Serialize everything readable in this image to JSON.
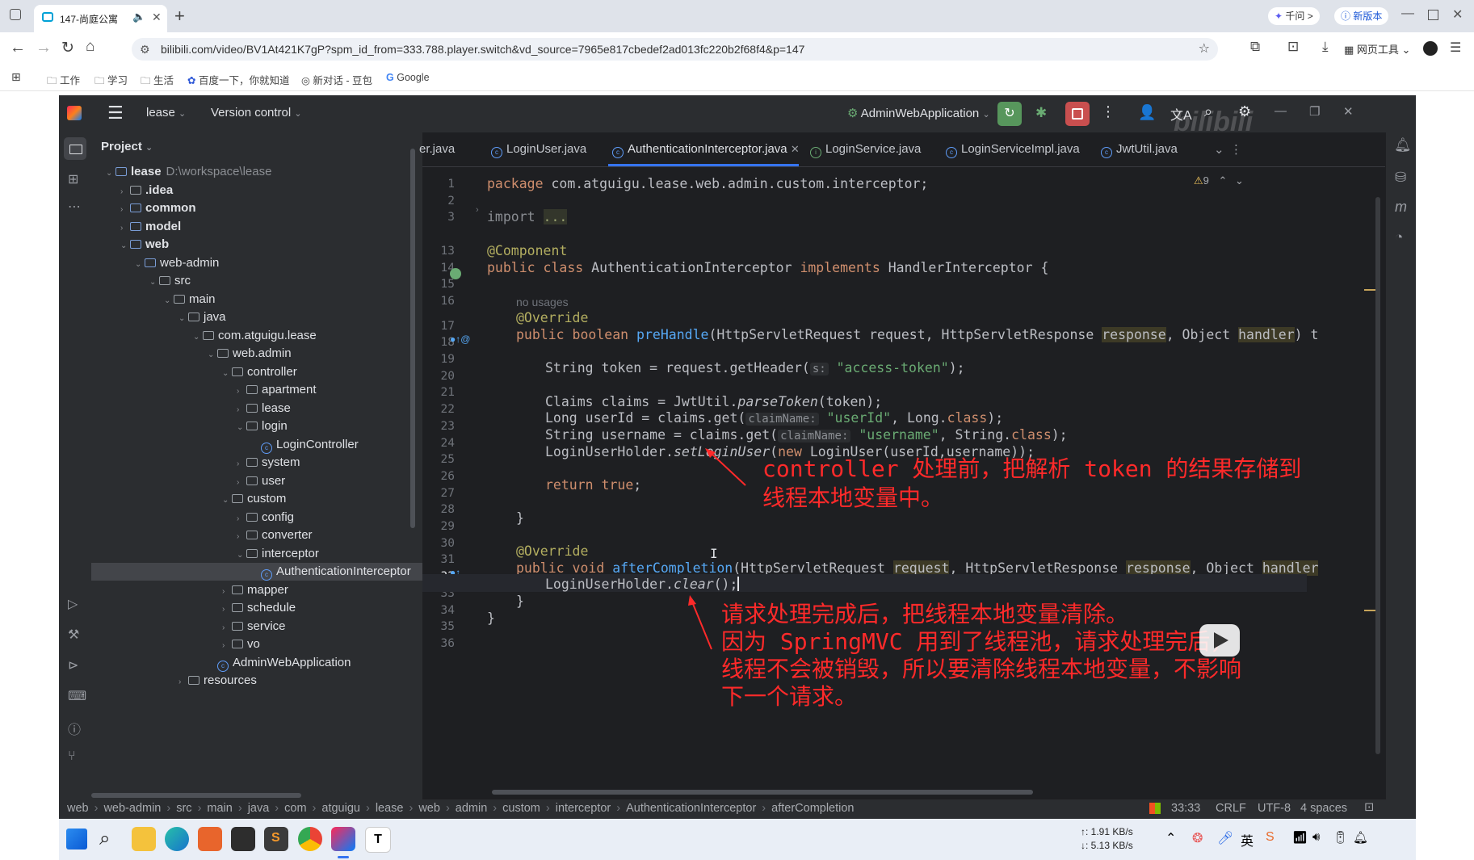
{
  "browser": {
    "tab_title": "147-尚庭公寓",
    "url": "bilibili.com/video/BV1At421K7gP?spm_id_from=333.788.player.switch&vd_source=7965e817cbedef2ad013fc220b2f68f4&p=147",
    "ask_btn": "千问 >",
    "new_version_btn": "新版本",
    "web_tools": "网页工具",
    "bookmarks": [
      "工作",
      "学习",
      "生活",
      "百度一下，你就知道",
      "新对话 - 豆包",
      "Google"
    ]
  },
  "ide": {
    "project_name": "lease",
    "version_control": "Version control",
    "run_config": "AdminWebApplication",
    "project_panel_title": "Project",
    "warnings_count": "9",
    "tabs": [
      {
        "label": "er.java",
        "active": false
      },
      {
        "label": "LoginUser.java",
        "active": false
      },
      {
        "label": "AuthenticationInterceptor.java",
        "active": true
      },
      {
        "label": "LoginService.java",
        "active": false
      },
      {
        "label": "LoginServiceImpl.java",
        "active": false
      },
      {
        "label": "JwtUtil.java",
        "active": false
      }
    ],
    "tree": [
      {
        "label": "lease",
        "extra": "D:\\workspace\\lease",
        "depth": 0,
        "arrow": "down",
        "icon": "module"
      },
      {
        "label": ".idea",
        "depth": 1,
        "arrow": "right",
        "icon": "folder"
      },
      {
        "label": "common",
        "depth": 1,
        "arrow": "right",
        "icon": "module"
      },
      {
        "label": "model",
        "depth": 1,
        "arrow": "right",
        "icon": "module"
      },
      {
        "label": "web",
        "depth": 1,
        "arrow": "down",
        "icon": "module"
      },
      {
        "label": "web-admin",
        "depth": 2,
        "arrow": "down",
        "icon": "module"
      },
      {
        "label": "src",
        "depth": 3,
        "arrow": "down",
        "icon": "folder"
      },
      {
        "label": "main",
        "depth": 4,
        "arrow": "down",
        "icon": "folder"
      },
      {
        "label": "java",
        "depth": 5,
        "arrow": "down",
        "icon": "folder"
      },
      {
        "label": "com.atguigu.lease",
        "depth": 6,
        "arrow": "down",
        "icon": "folder"
      },
      {
        "label": "web.admin",
        "depth": 7,
        "arrow": "down",
        "icon": "folder"
      },
      {
        "label": "controller",
        "depth": 8,
        "arrow": "down",
        "icon": "folder"
      },
      {
        "label": "apartment",
        "depth": 9,
        "arrow": "right",
        "icon": "folder"
      },
      {
        "label": "lease",
        "depth": 9,
        "arrow": "right",
        "icon": "folder"
      },
      {
        "label": "login",
        "depth": 9,
        "arrow": "down",
        "icon": "folder"
      },
      {
        "label": "LoginController",
        "depth": 10,
        "arrow": "",
        "icon": "class"
      },
      {
        "label": "system",
        "depth": 9,
        "arrow": "right",
        "icon": "folder"
      },
      {
        "label": "user",
        "depth": 9,
        "arrow": "right",
        "icon": "folder"
      },
      {
        "label": "custom",
        "depth": 8,
        "arrow": "down",
        "icon": "folder"
      },
      {
        "label": "config",
        "depth": 9,
        "arrow": "right",
        "icon": "folder"
      },
      {
        "label": "converter",
        "depth": 9,
        "arrow": "right",
        "icon": "folder"
      },
      {
        "label": "interceptor",
        "depth": 9,
        "arrow": "down",
        "icon": "folder"
      },
      {
        "label": "AuthenticationInterceptor",
        "depth": 10,
        "arrow": "",
        "icon": "class",
        "selected": true
      },
      {
        "label": "mapper",
        "depth": 8,
        "arrow": "right",
        "icon": "folder"
      },
      {
        "label": "schedule",
        "depth": 8,
        "arrow": "right",
        "icon": "folder"
      },
      {
        "label": "service",
        "depth": 8,
        "arrow": "right",
        "icon": "folder"
      },
      {
        "label": "vo",
        "depth": 8,
        "arrow": "right",
        "icon": "folder"
      },
      {
        "label": "AdminWebApplication",
        "depth": 7,
        "arrow": "",
        "icon": "app"
      },
      {
        "label": "resources",
        "depth": 5,
        "arrow": "right",
        "icon": "folder"
      }
    ],
    "gutter_lines": [
      "1",
      "2",
      "3",
      "13",
      "14",
      "15",
      "16",
      "17",
      "18",
      "19",
      "20",
      "21",
      "22",
      "23",
      "24",
      "25",
      "26",
      "27",
      "28",
      "29",
      "30",
      "31",
      "32",
      "33",
      "34",
      "35",
      "36"
    ],
    "code": {
      "package_kw": "package",
      "package_name": " com.atguigu.lease.web.admin.custom.interceptor;",
      "import_kw": "import",
      "import_fold": "...",
      "component": "@Component",
      "class_public": "public",
      "class_kw": "class",
      "class_name": " AuthenticationInterceptor ",
      "implements_kw": "implements",
      "class_tail": " HandlerInterceptor {",
      "no_usages": "no usages",
      "override": "@Override",
      "ph_public": "public",
      "ph_boolean": "boolean",
      "ph_name": "preHandle",
      "ph_args1": "(HttpServletRequest request, HttpServletResponse ",
      "ph_response": "response",
      "ph_args2": ", Object ",
      "ph_handler": "handler",
      "ph_tail": ") t",
      "l20_a": "String token = request.getHeader(",
      "l20_hint": "s:",
      "l20_str": "\"access-token\"",
      "l20_end": ");",
      "l22_a": "Claims claims = JwtUtil.",
      "l22_fn": "parseToken",
      "l22_end": "(token);",
      "l23_a": "Long userId = claims.get(",
      "l23_hint": "claimName:",
      "l23_str": "\"userId\"",
      "l23_b": ", Long.",
      "l23_cls": "class",
      "l23_end": ");",
      "l24_a": "String username = claims.get(",
      "l24_hint": "claimName:",
      "l24_str": "\"username\"",
      "l24_b": ", String.",
      "l24_cls": "class",
      "l24_end": ");",
      "l25_a": "LoginUserHolder.",
      "l25_fn": "setLoginUser",
      "l25_b": "(",
      "l25_new": "new",
      "l25_end": " LoginUser(userId,username));",
      "return_kw": "return",
      "true_kw": "true",
      "return_end": ";",
      "close_brace": "}",
      "override2": "@Override",
      "ac_public": "public",
      "ac_void": "void",
      "ac_name": "afterCompletion",
      "ac_args1": "(HttpServletRequest ",
      "ac_request": "request",
      "ac_args2": ", HttpServletResponse ",
      "ac_response": "response",
      "ac_args3": ", Object ",
      "ac_handler": "handler",
      "l33_a": "LoginUserHolder.",
      "l33_fn": "clear",
      "l33_end": "();",
      "inner_close": "}",
      "outer_close": "}"
    },
    "annotations": {
      "note1_line1": "controller 处理前，把解析 token 的结果存储到",
      "note1_line2": "线程本地变量中。",
      "note2_line1": "请求处理完成后，把线程本地变量清除。",
      "note2_line2": "因为 SpringMVC 用到了线程池，请求处理完后，",
      "note2_line3": "线程不会被销毁，所以要清除线程本地变量，不影响",
      "note2_line4": "下一个请求。",
      "color": "#ff2a2a"
    },
    "breadcrumbs": [
      "web",
      "web-admin",
      "src",
      "main",
      "java",
      "com",
      "atguigu",
      "lease",
      "web",
      "admin",
      "custom",
      "interceptor",
      "AuthenticationInterceptor",
      "afterCompletion"
    ],
    "status": {
      "position": "33:33",
      "line_sep": "CRLF",
      "encoding": "UTF-8",
      "indent": "4 spaces"
    }
  },
  "taskbar": {
    "net_up": "↑: 1.91 KB/s",
    "net_down": "↓: 5.13 KB/s"
  },
  "watermark": "bilibili"
}
